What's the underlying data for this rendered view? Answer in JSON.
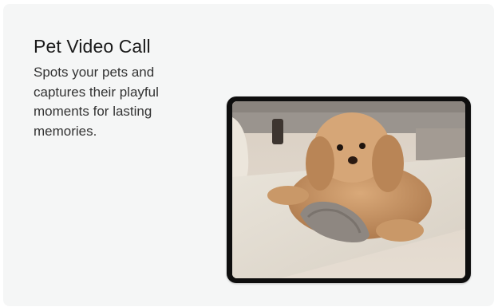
{
  "card": {
    "title": "Pet Video Call",
    "description": "Spots your pets and captures their playful moments for lasting memories."
  },
  "image": {
    "subject": "dog-photo"
  }
}
